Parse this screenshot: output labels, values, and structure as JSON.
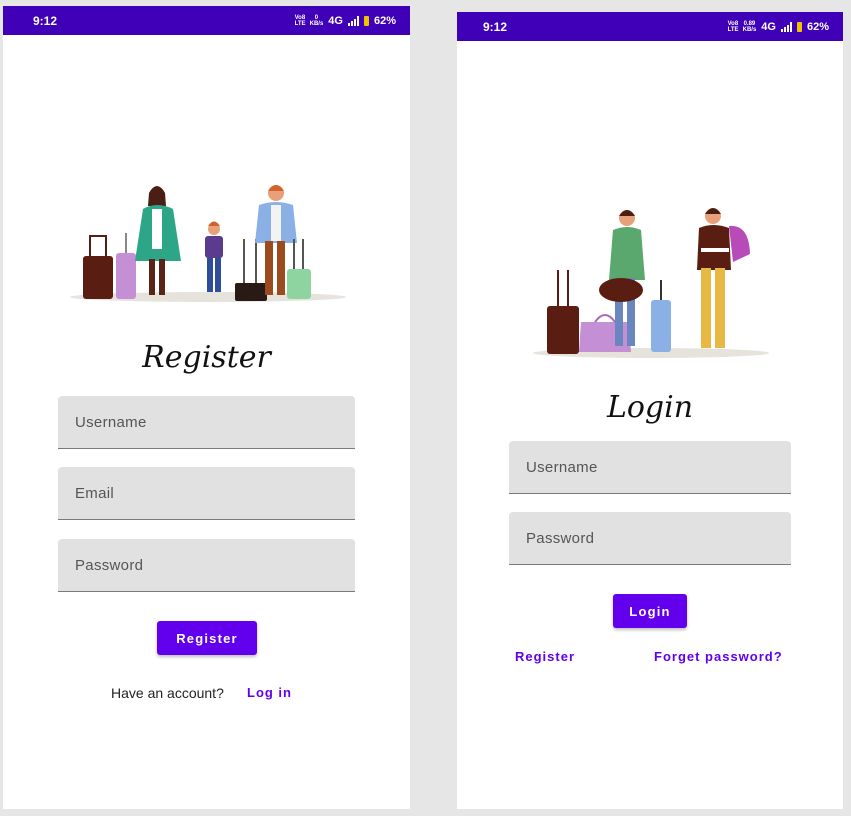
{
  "register_screen": {
    "status_time": "9:12",
    "status_net_top": "0",
    "status_net_bottom": "KB/s",
    "status_volte": "Vo8 LTE",
    "status_network": "4G",
    "status_battery": "62%",
    "title": "Register",
    "username_placeholder": "Username",
    "email_placeholder": "Email",
    "password_placeholder": "Password",
    "register_button": "Register",
    "have_account_text": "Have an account?",
    "login_link": "Log in"
  },
  "login_screen": {
    "status_time": "9:12",
    "status_net_top": "0.89",
    "status_net_bottom": "KB/s",
    "status_volte": "Vo8 LTE",
    "status_network": "4G",
    "status_battery": "62%",
    "title": "Login",
    "username_placeholder": "Username",
    "password_placeholder": "Password",
    "login_button": "Login",
    "register_link": "Register",
    "forget_password_link": "Forget password?"
  },
  "colors": {
    "statusbar": "#3f00b8",
    "accent": "#6200ee",
    "field_bg": "#e1e1e1"
  },
  "icons": [
    "signal-icon",
    "battery-icon",
    "family-travel-illustration",
    "travelers-illustration"
  ]
}
